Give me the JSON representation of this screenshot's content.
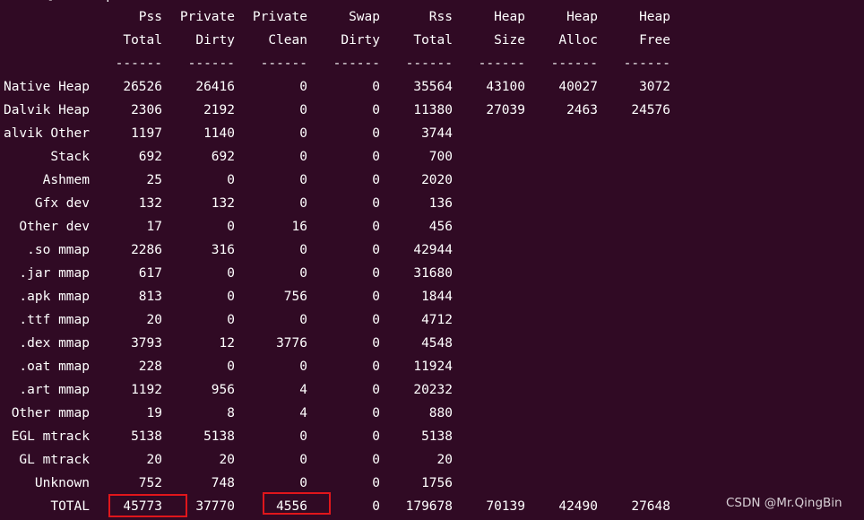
{
  "terminal": {
    "top_fragment": "      ]      q      J  J"
  },
  "header": {
    "line1": [
      "",
      "Pss",
      "Private",
      "Private",
      "Swap",
      "Rss",
      "Heap",
      "Heap",
      "Heap"
    ],
    "line2": [
      "",
      "Total",
      "Dirty",
      "Clean",
      "Dirty",
      "Total",
      "Size",
      "Alloc",
      "Free"
    ],
    "separator": [
      "",
      "------",
      "------",
      "------",
      "------",
      "------",
      "------",
      "------",
      "------"
    ]
  },
  "rows": [
    [
      "Native Heap",
      "26526",
      "26416",
      "0",
      "0",
      "35564",
      "43100",
      "40027",
      "3072"
    ],
    [
      "Dalvik Heap",
      "2306",
      "2192",
      "0",
      "0",
      "11380",
      "27039",
      "2463",
      "24576"
    ],
    [
      "alvik Other",
      "1197",
      "1140",
      "0",
      "0",
      "3744",
      "",
      "",
      ""
    ],
    [
      "Stack",
      "692",
      "692",
      "0",
      "0",
      "700",
      "",
      "",
      ""
    ],
    [
      "Ashmem",
      "25",
      "0",
      "0",
      "0",
      "2020",
      "",
      "",
      ""
    ],
    [
      "Gfx dev",
      "132",
      "132",
      "0",
      "0",
      "136",
      "",
      "",
      ""
    ],
    [
      "Other dev",
      "17",
      "0",
      "16",
      "0",
      "456",
      "",
      "",
      ""
    ],
    [
      ".so mmap",
      "2286",
      "316",
      "0",
      "0",
      "42944",
      "",
      "",
      ""
    ],
    [
      ".jar mmap",
      "617",
      "0",
      "0",
      "0",
      "31680",
      "",
      "",
      ""
    ],
    [
      ".apk mmap",
      "813",
      "0",
      "756",
      "0",
      "1844",
      "",
      "",
      ""
    ],
    [
      ".ttf mmap",
      "20",
      "0",
      "0",
      "0",
      "4712",
      "",
      "",
      ""
    ],
    [
      ".dex mmap",
      "3793",
      "12",
      "3776",
      "0",
      "4548",
      "",
      "",
      ""
    ],
    [
      ".oat mmap",
      "228",
      "0",
      "0",
      "0",
      "11924",
      "",
      "",
      ""
    ],
    [
      ".art mmap",
      "1192",
      "956",
      "4",
      "0",
      "20232",
      "",
      "",
      ""
    ],
    [
      "Other mmap",
      "19",
      "8",
      "4",
      "0",
      "880",
      "",
      "",
      ""
    ],
    [
      "EGL mtrack",
      "5138",
      "5138",
      "0",
      "0",
      "5138",
      "",
      "",
      ""
    ],
    [
      "GL mtrack",
      "20",
      "20",
      "0",
      "0",
      "20",
      "",
      "",
      ""
    ],
    [
      "Unknown",
      "752",
      "748",
      "0",
      "0",
      "1756",
      "",
      "",
      ""
    ],
    [
      "TOTAL",
      "45773",
      "37770",
      "4556",
      "0",
      "179678",
      "70139",
      "42490",
      "27648"
    ]
  ],
  "annotations": {
    "highlight_color": "#e0161b",
    "highlighted_cells": [
      "TOTAL Pss Total",
      "TOTAL Private Clean"
    ]
  },
  "watermark": "CSDN @Mr.QingBin",
  "colors": {
    "background": "#300a24",
    "text": "#ffffff"
  }
}
